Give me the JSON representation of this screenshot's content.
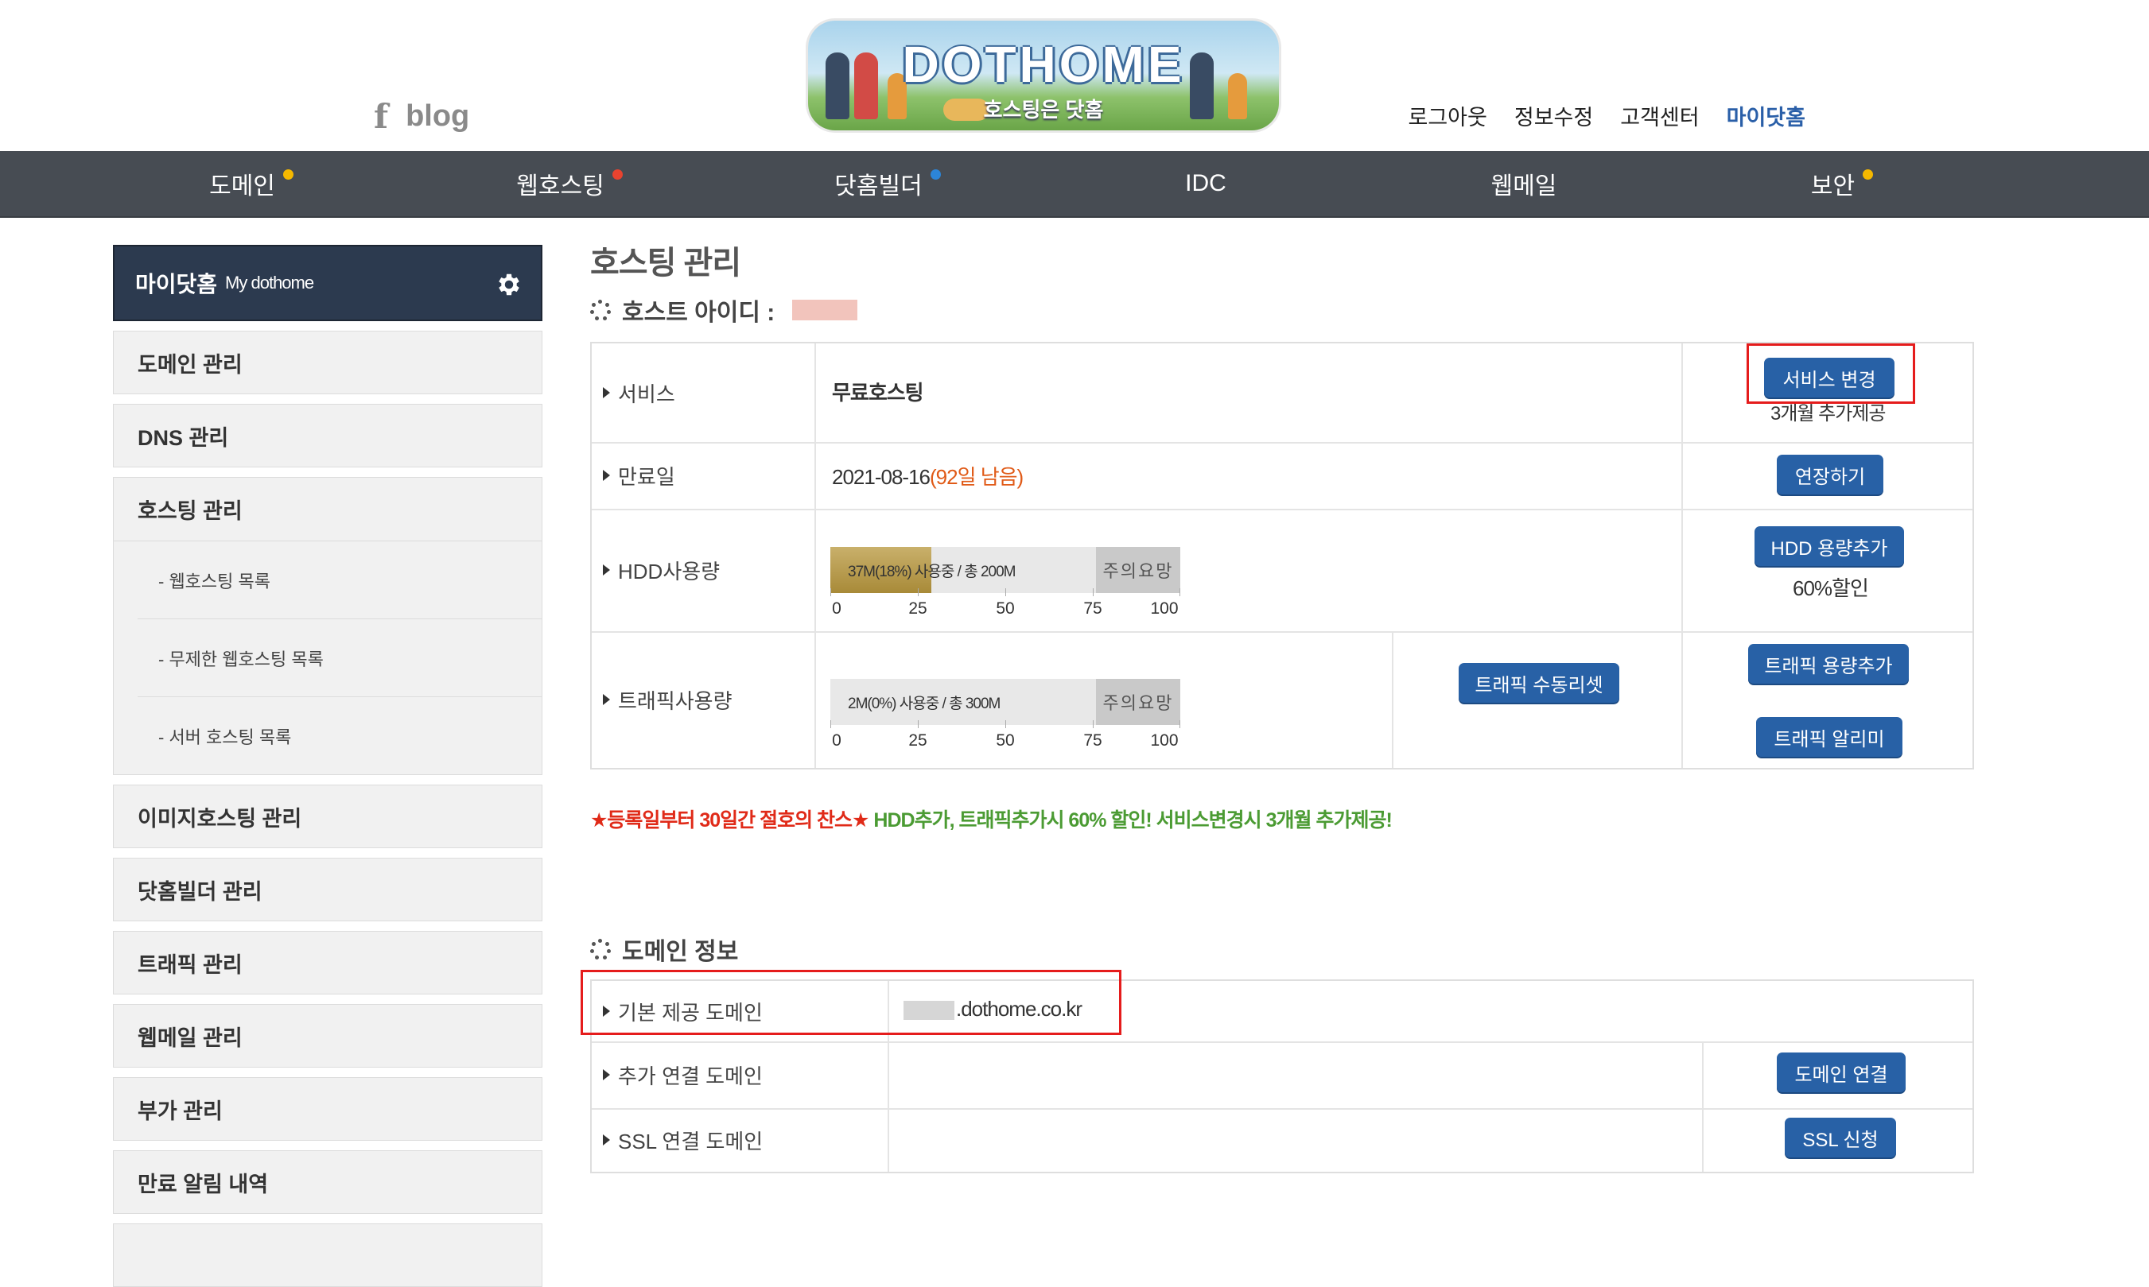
{
  "header": {
    "blog_f": "f",
    "blog_label": "blog",
    "logo_title": "DOTHOME",
    "logo_subtitle": "호스팅은 닷홈",
    "links": [
      "로그아웃",
      "정보수정",
      "고객센터",
      "마이닷홈"
    ]
  },
  "nav": {
    "items": [
      {
        "label": "도메인",
        "dot": "#f5b800"
      },
      {
        "label": "웹호스팅",
        "dot": "#e8432f"
      },
      {
        "label": "닷홈빌더",
        "dot": "#2c85d8"
      },
      {
        "label": "IDC",
        "dot": ""
      },
      {
        "label": "웹메일",
        "dot": ""
      },
      {
        "label": "보안",
        "dot": "#f5b800"
      }
    ]
  },
  "sidebar": {
    "title": "마이닷홈",
    "title_en": "My dothome",
    "items": [
      "도메인 관리",
      "DNS 관리"
    ],
    "hosting_group": {
      "label": "호스팅 관리",
      "subs": [
        "- 웹호스팅 목록",
        "- 무제한 웹호스팅 목록",
        "- 서버 호스팅 목록"
      ]
    },
    "items_after": [
      "이미지호스팅 관리",
      "닷홈빌더 관리",
      "트래픽 관리",
      "웹메일 관리",
      "부가 관리",
      "만료 알림 내역"
    ]
  },
  "main": {
    "page_title": "호스팅 관리",
    "host_id_label": "호스트 아이디 :",
    "service": {
      "label": "서비스",
      "value": "무료호스팅",
      "button": "서비스 변경",
      "note": "3개월 추가제공"
    },
    "expiry": {
      "label": "만료일",
      "date": "2021-08-16",
      "remaining": "(92일 남음)",
      "button": "연장하기"
    },
    "hdd": {
      "label": "HDD사용량",
      "bar_text": "37M(18%) 사용중 / 총 200M",
      "usage_fraction": 0.18,
      "warn": "주의요망",
      "ticks": [
        "0",
        "25",
        "50",
        "75",
        "100"
      ],
      "button": "HDD 용량추가",
      "note": "60%할인"
    },
    "traffic": {
      "label": "트래픽사용량",
      "bar_text": "2M(0%) 사용중 / 총 300M",
      "usage_fraction": 0,
      "warn": "주의요망",
      "ticks": [
        "0",
        "25",
        "50",
        "75",
        "100"
      ],
      "reset_button": "트래픽 수동리셋",
      "add_button": "트래픽 용량추가",
      "alarm_button": "트래픽 알리미"
    },
    "promo": {
      "red": "★등록일부터 30일간 절호의 찬스★",
      "green": " HDD추가, 트래픽추가시 60% 할인! 서비스변경시 3개월 추가제공!"
    },
    "domain_info": {
      "title": "도메인 정보",
      "default_label": "기본 제공 도메인",
      "default_value": ".dothome.co.kr",
      "extra_label": "추가 연결 도메인",
      "extra_button": "도메인 연결",
      "ssl_label": "SSL 연결 도메인",
      "ssl_button": "SSL 신청"
    }
  },
  "colors": {
    "nav_bg": "#474c53",
    "sidebar_head": "#2c3a4f",
    "button_blue": "#2861a6",
    "accent_orange": "#e05a17",
    "highlight_red": "#e51c1c"
  }
}
